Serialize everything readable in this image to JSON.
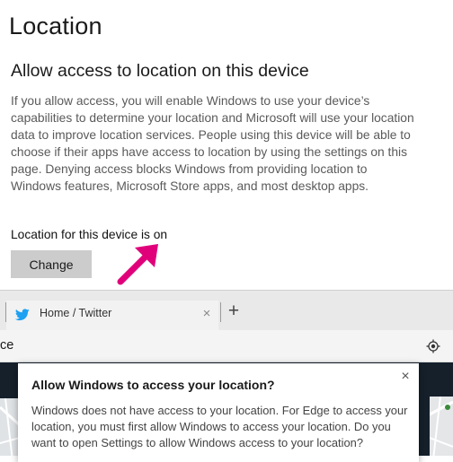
{
  "settings": {
    "page_title": "Location",
    "section_title": "Allow access to location on this device",
    "description": "If you allow access, you will enable Windows to use your device’s capabilities to determine your location and Microsoft will use your location data to improve location services. People using this device will be able to choose if their apps have access to location by using the settings on this page. Denying access blocks Windows from providing location to Windows features, Microsoft Store apps, and most desktop apps.",
    "status_text": "Location for this device is on",
    "change_label": "Change",
    "annotation_color": "#e0007a"
  },
  "browser": {
    "tab": {
      "title": "Home / Twitter",
      "icon": "twitter-icon",
      "close_glyph": "×"
    },
    "new_tab_glyph": "+",
    "address_text": "ce",
    "accent_color": "#1da1f2",
    "page_background": "#15202b"
  },
  "dialog": {
    "title": "Allow Windows to access your location?",
    "body": "Windows does not have access to your location. For Edge to access your location, you must first allow Windows to access your location. Do you want to open Settings to allow Windows access to your location?",
    "close_glyph": "×"
  }
}
